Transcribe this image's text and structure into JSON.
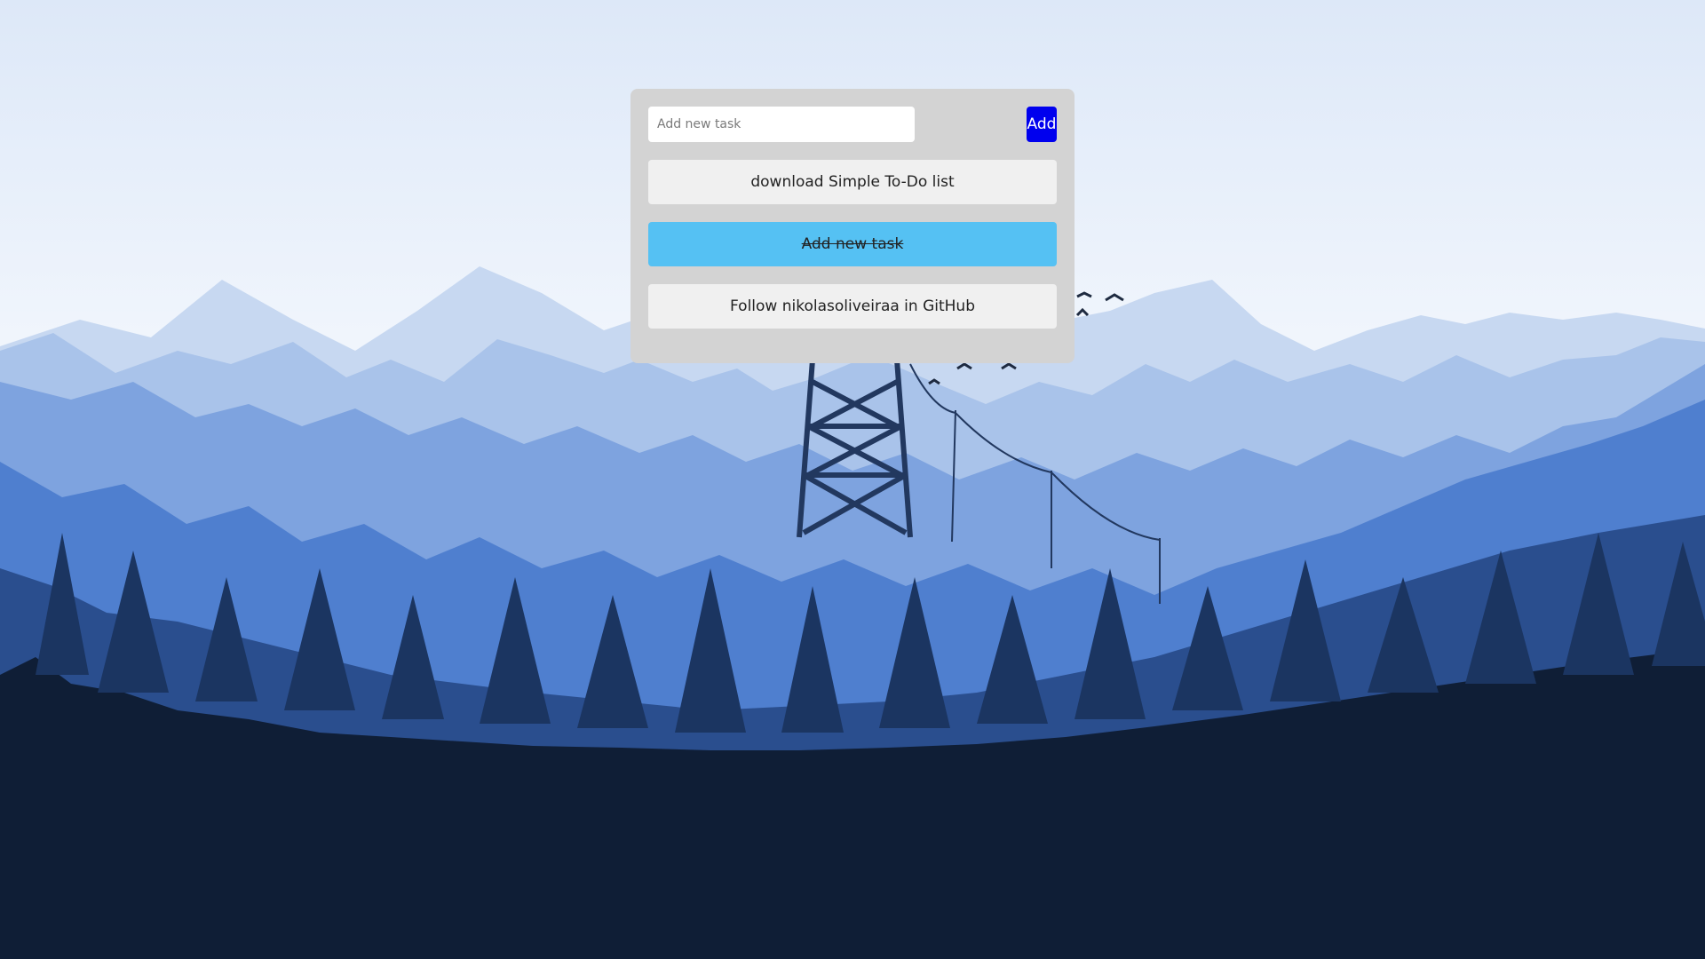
{
  "input": {
    "placeholder": "Add new task",
    "value": ""
  },
  "add_button": {
    "label": "Add"
  },
  "tasks": [
    {
      "label": "download Simple To-Do list",
      "done": false
    },
    {
      "label": "Add new task",
      "done": true
    },
    {
      "label": "Follow nikolasoliveiraa in GitHub",
      "done": false
    }
  ],
  "colors": {
    "panel": "#d3d3d3",
    "add_button": "#0000ee",
    "task_done": "#55c1f3",
    "task_default": "#f0f0f0"
  }
}
